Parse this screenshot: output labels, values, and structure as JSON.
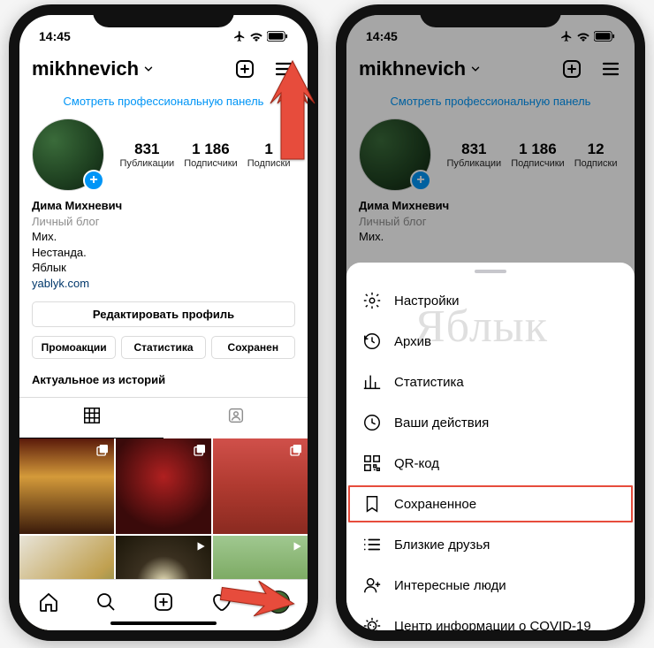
{
  "status": {
    "time": "14:45"
  },
  "header": {
    "username": "mikhnevich"
  },
  "proLink": "Смотреть профессиональную панель",
  "stats": {
    "posts": {
      "num": "831",
      "label": "Публикации"
    },
    "followers": {
      "num": "1 186",
      "label": "Подписчики"
    },
    "following_left": {
      "num": "1",
      "label": "Подписки"
    },
    "following": {
      "num": "12",
      "label": "Подписки"
    }
  },
  "bio": {
    "name": "Дима Михневич",
    "category": "Личный блог",
    "line1": "Мих.",
    "line2": "Нестанда.",
    "line3": "Яблык",
    "link": "yablyk.com"
  },
  "editProfile": "Редактировать профиль",
  "tabs": {
    "promo": "Промоакции",
    "stats": "Статистика",
    "saved": "Сохранен"
  },
  "highlightsLabel": "Актуальное из историй",
  "menu": {
    "settings": "Настройки",
    "archive": "Архив",
    "statistics": "Статистика",
    "activity": "Ваши действия",
    "qr": "QR-код",
    "saved": "Сохраненное",
    "closeFriends": "Близкие друзья",
    "discover": "Интересные люди",
    "covid": "Центр информации о COVID-19"
  },
  "watermark": "Яблык"
}
